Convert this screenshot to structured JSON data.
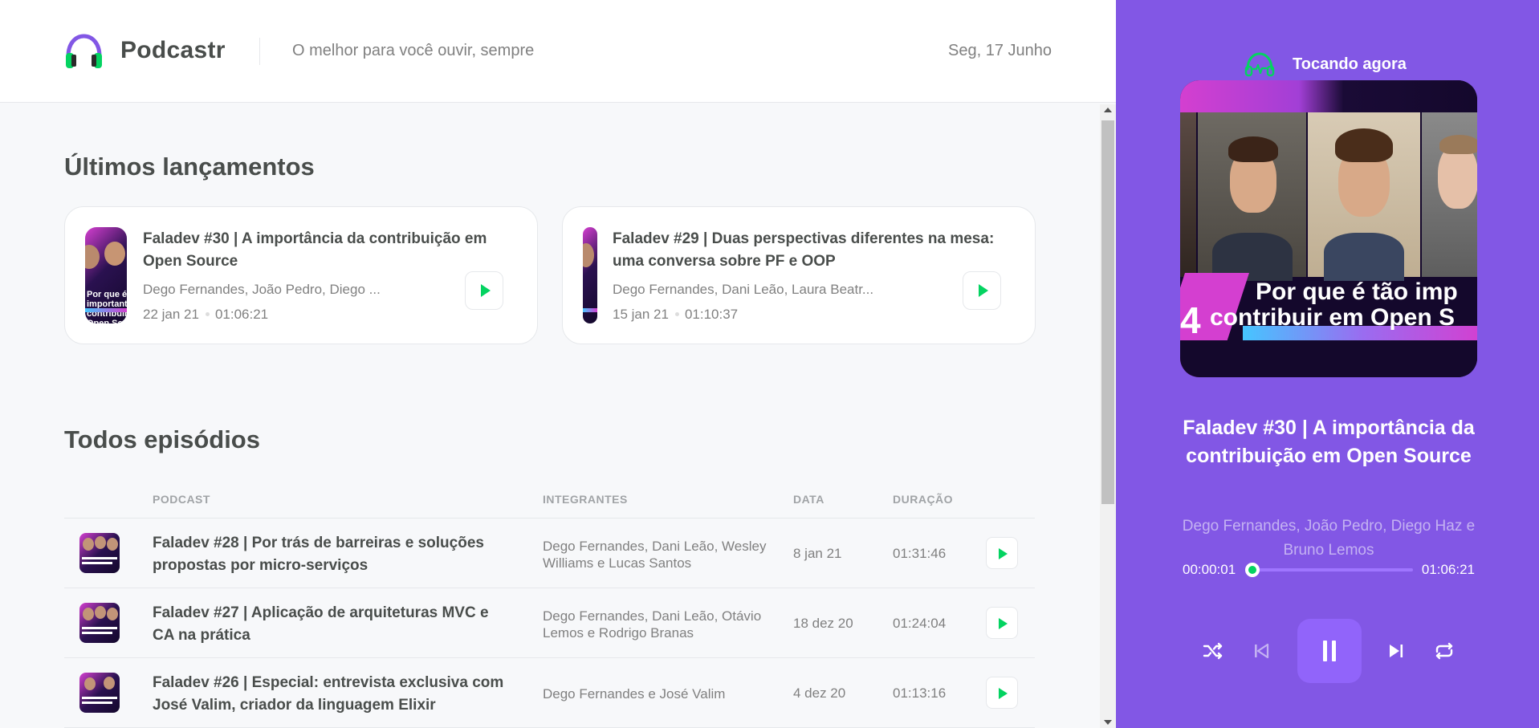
{
  "header": {
    "logo_text": "Podcastr",
    "tagline": "O melhor para você ouvir, sempre",
    "date": "Seg, 17 Junho"
  },
  "latest": {
    "title": "Últimos lançamentos",
    "cards": [
      {
        "title": "Faladev #30 | A importância da contribuição em Open Source",
        "members": "Dego Fernandes, João Pedro, Diego ...",
        "date": "22 jan 21",
        "duration": "01:06:21",
        "thumb_text": "Por que é tão importante contribuir em Open Source"
      },
      {
        "title": "Faladev #29 | Duas perspectivas diferentes na mesa: uma conversa sobre PF e OOP",
        "members": "Dego Fernandes, Dani Leão, Laura Beatr...",
        "date": "15 jan 21",
        "duration": "01:10:37"
      }
    ]
  },
  "all": {
    "title": "Todos episódios",
    "columns": [
      "PODCAST",
      "INTEGRANTES",
      "DATA",
      "DURAÇÃO"
    ],
    "rows": [
      {
        "title": "Faladev #28 | Por trás de barreiras e soluções propostas por micro-serviços",
        "members": "Dego Fernandes, Dani Leão, Wesley Williams e Lucas Santos",
        "date": "8 jan 21",
        "duration": "01:31:46"
      },
      {
        "title": "Faladev #27 | Aplicação de arquiteturas MVC e CA na prática",
        "members": "Dego Fernandes, Dani Leão, Otávio Lemos e Rodrigo Branas",
        "date": "18 dez 20",
        "duration": "01:24:04"
      },
      {
        "title": "Faladev #26 | Especial: entrevista exclusiva com José Valim, criador da linguagem Elixir",
        "members": "Dego Fernandes e José Valim",
        "date": "4 dez 20",
        "duration": "01:13:16"
      }
    ]
  },
  "player": {
    "label": "Tocando agora",
    "cover_text_line1": "Por que é tão imp",
    "cover_text_line2": "contribuir em Open S",
    "cover_number": "4",
    "title": "Faladev #30 | A importância da contribuição em Open Source",
    "members": "Dego Fernandes, João Pedro, Diego Haz e Bruno Lemos",
    "current_time": "00:00:01",
    "total_time": "01:06:21",
    "progress_fraction": 0.0003
  },
  "colors": {
    "accent": "#8257e5",
    "green": "#04d361",
    "text": "#494d4b",
    "muted": "#808080"
  },
  "icons": [
    "headphones-icon",
    "play-icon",
    "shuffle-icon",
    "previous-icon",
    "pause-icon",
    "next-icon",
    "repeat-icon"
  ]
}
